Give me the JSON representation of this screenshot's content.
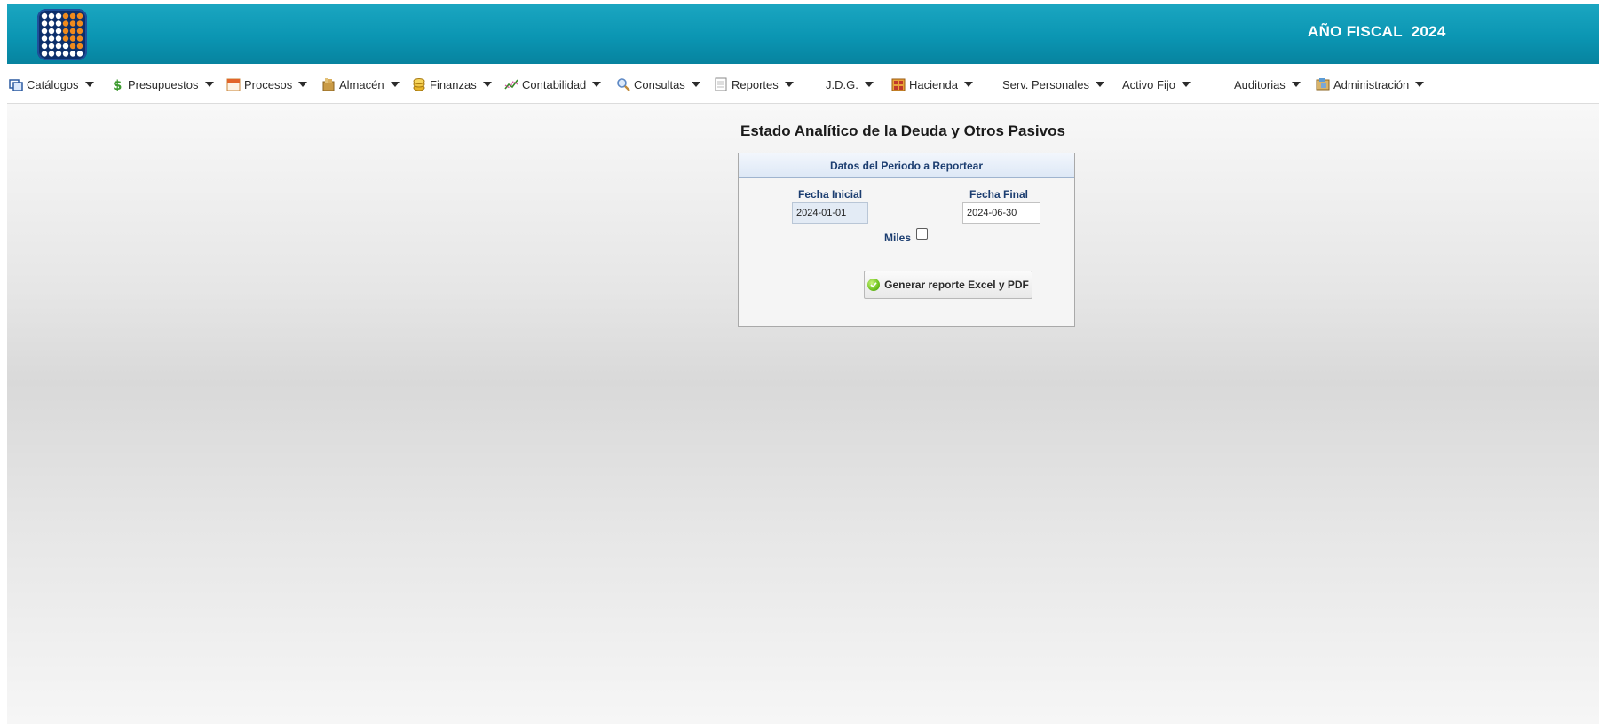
{
  "header": {
    "fiscal_label": "AÑO FISCAL  2024"
  },
  "menu": [
    {
      "label": "Catálogos",
      "icon": "window-icon"
    },
    {
      "label": "Presupuestos",
      "icon": "dollar-icon"
    },
    {
      "label": "Procesos",
      "icon": "calendar-icon"
    },
    {
      "label": "Almacén",
      "icon": "box-icon"
    },
    {
      "label": "Finanzas",
      "icon": "coins-icon"
    },
    {
      "label": "Contabilidad",
      "icon": "chart-icon"
    },
    {
      "label": "Consultas",
      "icon": "magnifier-icon"
    },
    {
      "label": "Reportes",
      "icon": "document-icon"
    },
    {
      "label": "J.D.G.",
      "icon": ""
    },
    {
      "label": "Hacienda",
      "icon": "bank-icon"
    },
    {
      "label": "Serv. Personales",
      "icon": ""
    },
    {
      "label": "Activo Fijo",
      "icon": ""
    },
    {
      "label": "Auditorias",
      "icon": ""
    },
    {
      "label": "Administración",
      "icon": "folder-icon"
    }
  ],
  "page": {
    "title": "Estado Analítico de la Deuda y Otros Pasivos"
  },
  "form": {
    "panel_title": "Datos del Periodo a Reportear",
    "fecha_inicial_label": "Fecha Inicial",
    "fecha_inicial_value": "2024-01-01",
    "fecha_final_label": "Fecha Final",
    "fecha_final_value": "2024-06-30",
    "miles_label": "Miles",
    "miles_checked": false,
    "generate_button_label": "Generar reporte Excel y PDF"
  },
  "colors": {
    "header_top": "#1ba6c1",
    "header_bottom": "#07839f",
    "label_blue": "#1b3d70"
  }
}
